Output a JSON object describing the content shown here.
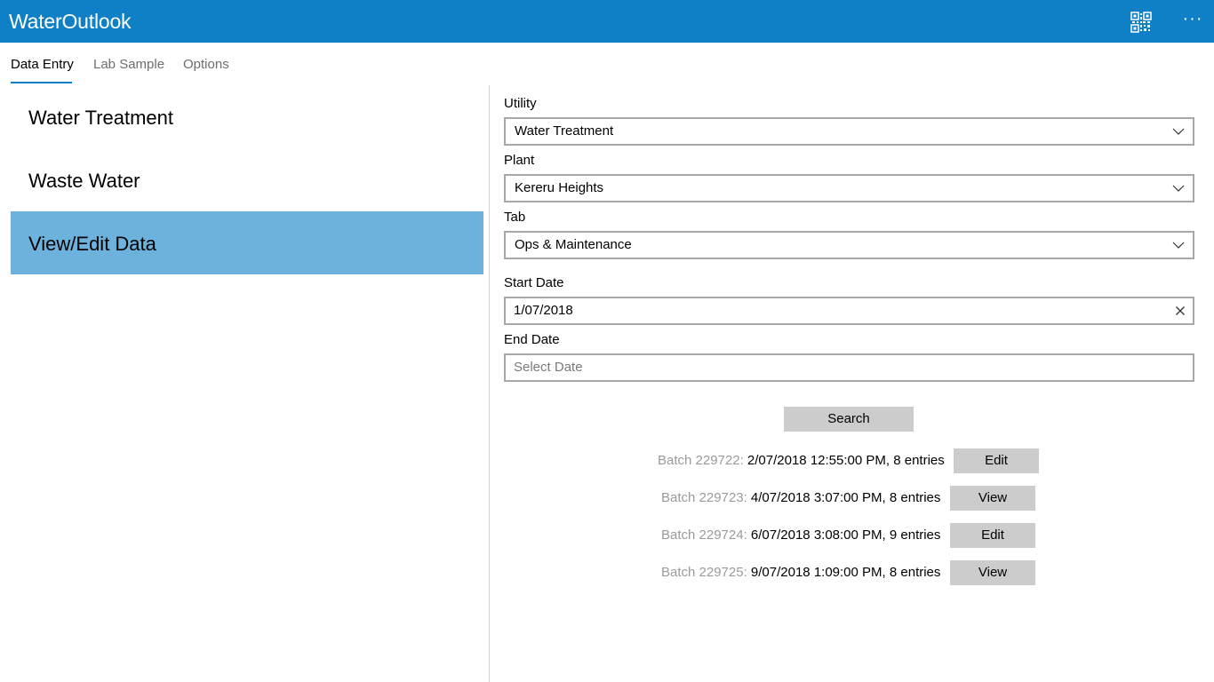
{
  "app": {
    "title": "WaterOutlook",
    "qr_icon": "qr-code-icon",
    "more_icon": "more-icon",
    "more_label": "···"
  },
  "tabs": [
    {
      "label": "Data Entry",
      "active": true
    },
    {
      "label": "Lab Sample",
      "active": false
    },
    {
      "label": "Options",
      "active": false
    }
  ],
  "menu": {
    "items": [
      {
        "label": "Water Treatment",
        "selected": false
      },
      {
        "label": "Waste Water",
        "selected": false
      },
      {
        "label": "View/Edit Data",
        "selected": true
      }
    ]
  },
  "form": {
    "utility_label": "Utility",
    "utility_value": "Water Treatment",
    "plant_label": "Plant",
    "plant_value": "Kereru Heights",
    "tab_label": "Tab",
    "tab_value": "Ops & Maintenance",
    "start_date_label": "Start Date",
    "start_date_value": "1/07/2018",
    "end_date_label": "End Date",
    "end_date_placeholder": "Select Date",
    "search_label": "Search"
  },
  "batches": [
    {
      "id": "Batch 229722:",
      "detail": "2/07/2018 12:55:00 PM, 8 entries",
      "action": "Edit"
    },
    {
      "id": "Batch 229723:",
      "detail": "4/07/2018 3:07:00 PM, 8 entries",
      "action": "View"
    },
    {
      "id": "Batch 229724:",
      "detail": "6/07/2018 3:08:00 PM, 9 entries",
      "action": "Edit"
    },
    {
      "id": "Batch 229725:",
      "detail": "9/07/2018 1:09:00 PM, 8 entries",
      "action": "View"
    }
  ],
  "colors": {
    "accent": "#0f80c6",
    "selected_item": "#6cb2dc",
    "button_bg": "#cccccc",
    "batch_id_text": "#9a9a9a"
  }
}
